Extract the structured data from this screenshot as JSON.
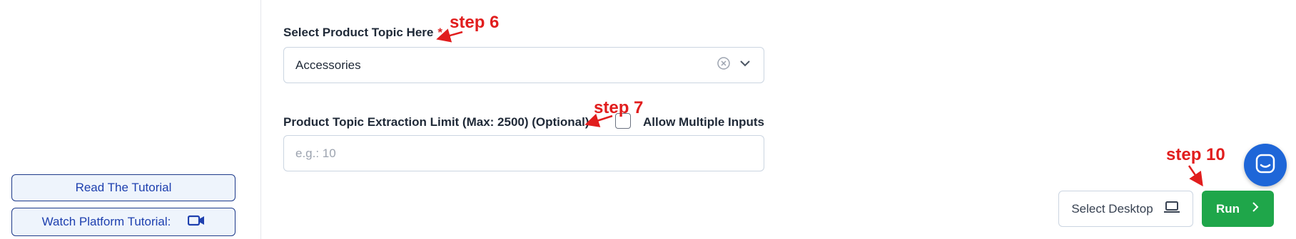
{
  "sidebar": {
    "read_tutorial": "Read The Tutorial",
    "watch_tutorial": "Watch Platform Tutorial:"
  },
  "form": {
    "topic_label": "Select Product Topic Here",
    "required_mark": "*",
    "topic_value": "Accessories",
    "limit_label": "Product Topic Extraction Limit (Max: 2500) (Optional)",
    "allow_multiple_label": "Allow Multiple Inputs",
    "limit_placeholder": "e.g.: 10"
  },
  "actions": {
    "select_desktop": "Select Desktop",
    "run": "Run"
  },
  "annotations": {
    "step6": "step 6",
    "step7": "step 7",
    "step10": "step 10"
  },
  "colors": {
    "accent_blue": "#1e40af",
    "run_green": "#1fa64a",
    "annotation_red": "#e11d1d",
    "chat_blue": "#1e66d8"
  },
  "icons": [
    "video-camera-icon",
    "clear-circle-icon",
    "chevron-down-icon",
    "laptop-icon",
    "chevron-right-icon",
    "chat-icon"
  ]
}
